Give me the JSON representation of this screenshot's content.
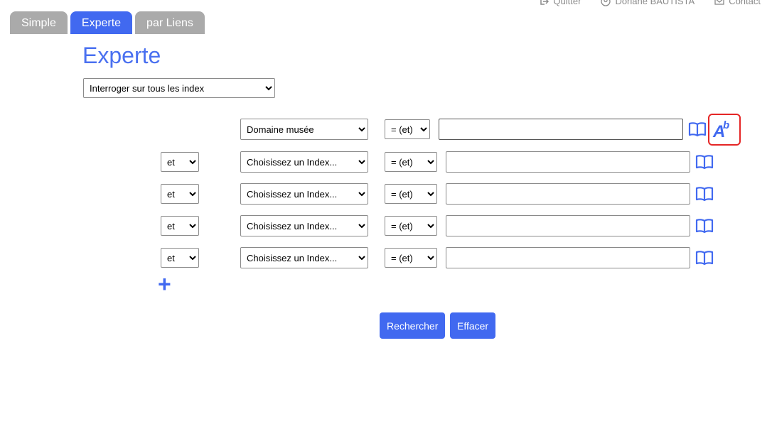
{
  "topbar": {
    "quit": "Quitter",
    "user": "Doriane BAUTISTA",
    "contact": "Contact"
  },
  "tabs": [
    {
      "label": "Simple"
    },
    {
      "label": "Experte"
    },
    {
      "label": "par Liens"
    }
  ],
  "page_title": "Experte",
  "index_selector": {
    "value": "Interroger sur tous les index"
  },
  "criteria": [
    {
      "index": "Domaine musée",
      "comparator": "= (et)",
      "value": ""
    },
    {
      "operator": "et",
      "index": "Choisissez un Index...",
      "comparator": "= (et)",
      "value": ""
    },
    {
      "operator": "et",
      "index": "Choisissez un Index...",
      "comparator": "= (et)",
      "value": ""
    },
    {
      "operator": "et",
      "index": "Choisissez un Index...",
      "comparator": "= (et)",
      "value": ""
    },
    {
      "operator": "et",
      "index": "Choisissez un Index...",
      "comparator": "= (et)",
      "value": ""
    }
  ],
  "case_button": {
    "letter": "A",
    "sup": "b"
  },
  "add_row": "+",
  "buttons": {
    "search": "Rechercher",
    "clear": "Effacer"
  },
  "colors": {
    "accent": "#4169f0",
    "tab_inactive": "#aaaaaa",
    "highlight": "#e52626"
  }
}
